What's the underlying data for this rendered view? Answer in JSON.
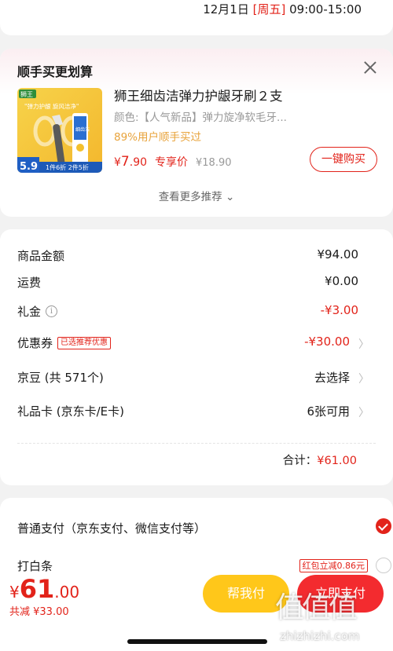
{
  "header": {
    "date": "12月1日",
    "weekday": "[周五]",
    "time_range": "09:00-15:00"
  },
  "recommend": {
    "title": "顺手买更划算",
    "product": {
      "name": "狮王细齿洁弹力护龈牙刷２支",
      "variant": "颜色:【人气新品】弹力旋净软毛牙...",
      "stat": "89%用户顺手买过",
      "price_symbol": "¥",
      "price_int": "7",
      "price_dec": ".90",
      "exclusive_label": "专享价",
      "original_price": "¥18.90",
      "buy_label": "一键购买",
      "image_text": {
        "brand": "狮王",
        "slogan": "\"弹力护龈 旋风洁净\"",
        "price_badge": "5.9",
        "deal": "1件6折 2件5折",
        "box_text": "细齿洁"
      }
    },
    "see_more": "查看更多推荐",
    "see_more_icon": "chevron-down-icon"
  },
  "summary": {
    "rows": [
      {
        "label": "商品金额",
        "value": "¥94.00"
      },
      {
        "label": "运费",
        "value": "¥0.00"
      },
      {
        "label": "礼金",
        "value": "-¥3.00",
        "info": "i"
      },
      {
        "label": "优惠券",
        "value": "-¥30.00",
        "tag": "已选推荐优惠"
      },
      {
        "label": "京豆 (共 571个)",
        "value": "去选择"
      },
      {
        "label": "礼品卡 (京东卡/E卡)",
        "value": "6张可用"
      }
    ],
    "total_label": "合计：",
    "total_value": "¥61.00"
  },
  "payment": {
    "normal": "普通支付（京东支付、微信支付等）",
    "baitiao": "打白条",
    "baitiao_promo": "红包立减0.86元"
  },
  "bottom": {
    "currency": "¥",
    "amount_int": "61",
    "amount_dec": ".00",
    "saved": "共减 ¥33.00",
    "help_pay": "帮我付",
    "pay": "立即支付"
  },
  "watermark": {
    "glyphs": "值值值",
    "url": "zhizhizhi.com"
  },
  "colors": {
    "accent_red": "#e2231a",
    "help_yellow": "#ffc71a",
    "pay_red": "#f32b2f",
    "stat_orange": "#e8a33b"
  }
}
